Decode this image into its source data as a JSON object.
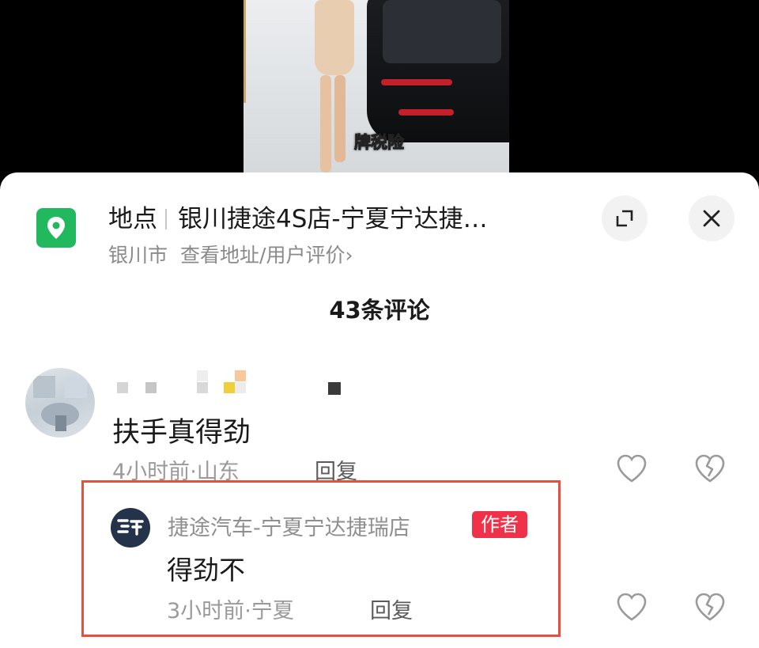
{
  "video": {
    "caption": "牌税险"
  },
  "location": {
    "label": "地点",
    "name": "银川捷途4S店-宁夏宁达捷…",
    "city": "银川市",
    "link": "查看地址/用户评价",
    "link_chevron": "›",
    "icon": "location-pin-icon",
    "icon_color": "#22b95e"
  },
  "header": {
    "comment_count": "43条评论",
    "expand_icon": "expand-icon",
    "close_icon": "close-icon"
  },
  "comments": [
    {
      "text": "扶手真得劲",
      "time": "4小时前",
      "separator": "·",
      "region": "山东",
      "reply_label": "回复",
      "like_icon": "heart-icon",
      "dislike_icon": "broken-heart-icon"
    }
  ],
  "author_reply": {
    "name": "捷途汽车-宁夏宁达捷瑞店",
    "badge": "作者",
    "badge_color": "#f0314a",
    "text": "得劲不",
    "time": "3小时前",
    "separator": "·",
    "region": "宁夏",
    "reply_label": "回复",
    "highlight_color": "#e4513f",
    "like_icon": "heart-icon",
    "dislike_icon": "broken-heart-icon"
  }
}
